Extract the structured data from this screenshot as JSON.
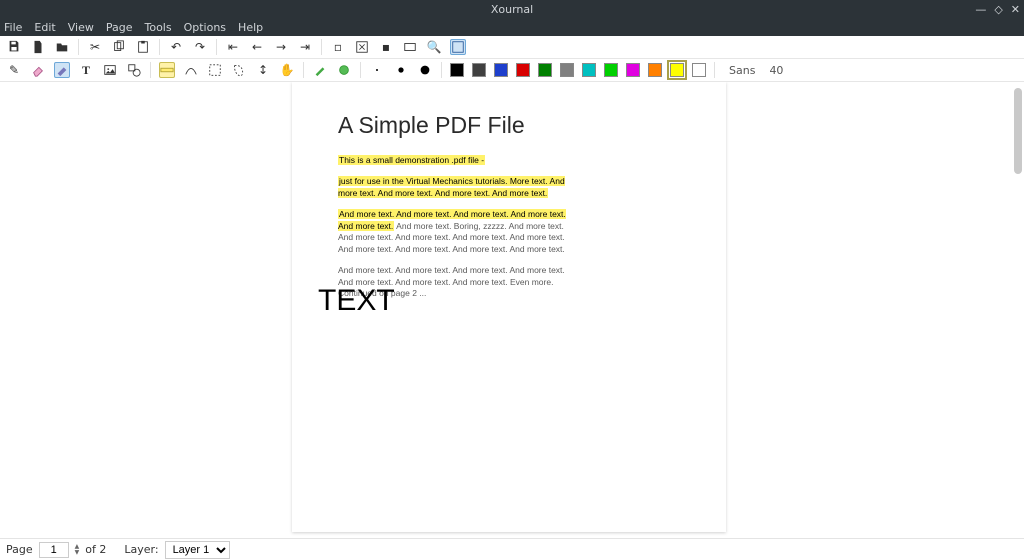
{
  "window": {
    "title": "Xournal"
  },
  "menu": {
    "file": "File",
    "edit": "Edit",
    "view": "View",
    "page": "Page",
    "tools": "Tools",
    "options": "Options",
    "help": "Help"
  },
  "font": {
    "family": "Sans",
    "size": "40"
  },
  "colors": {
    "black": "#000000",
    "darkgray": "#404040",
    "blue": "#1e3fcc",
    "red": "#d80000",
    "darkgreen": "#008000",
    "gray": "#808080",
    "cyan": "#00c0c0",
    "green": "#00d000",
    "magenta": "#e000e0",
    "orange": "#ff8000",
    "yellow": "#ffff00",
    "white": "#ffffff"
  },
  "doc": {
    "title": "A Simple PDF File",
    "p1": "This is a small demonstration .pdf file -",
    "p2": "just for use in the Virtual Mechanics tutorials. More text. And more text. And more text. And more text. And more text.",
    "p3": "And more text. And more text. And more text. And more text. And more text. And more text. Boring, zzzzz. And more text. And more text. And more text. And more text. And more text. And more text. And more text. And more text. And more text.",
    "p4": "And more text. And more text. And more text. And more text. And more text. And more text. And more text. Even more. Continued on page 2 ..."
  },
  "annotation": {
    "text": "TEXT"
  },
  "status": {
    "page_label": "Page",
    "page_current": "1",
    "page_total": "of 2",
    "layer_label": "Layer:",
    "layer_value": "Layer 1"
  }
}
